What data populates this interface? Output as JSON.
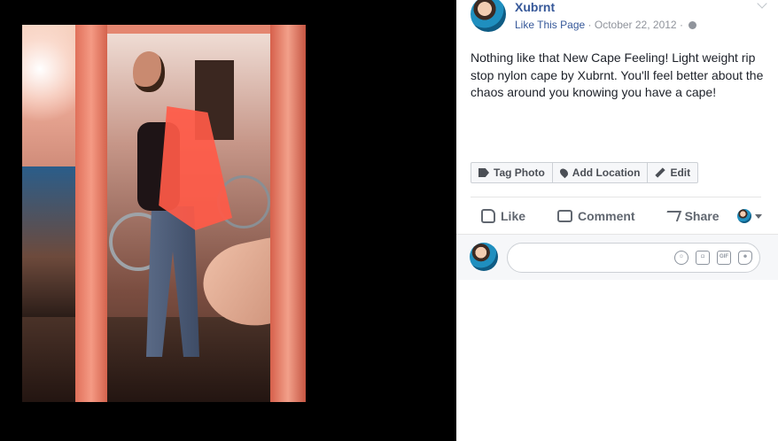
{
  "post": {
    "page_name": "Xubrnt",
    "like_link": "Like This Page",
    "date": "October 22, 2012",
    "caption": "Nothing like that New Cape Feeling! Light weight rip stop nylon cape by Xubrnt. You'll feel better about the chaos around you knowing you have a cape!"
  },
  "photo_tools": [
    {
      "label": "Tag Photo",
      "icon": "tag-icon"
    },
    {
      "label": "Add Location",
      "icon": "location-pin-icon"
    },
    {
      "label": "Edit",
      "icon": "pencil-icon"
    }
  ],
  "actions": {
    "like": "Like",
    "comment": "Comment",
    "share": "Share"
  },
  "comment_box": {
    "placeholder": ""
  },
  "colors": {
    "link": "#365899",
    "meta": "#90949c",
    "text": "#1d2129",
    "action_text": "#616770"
  }
}
